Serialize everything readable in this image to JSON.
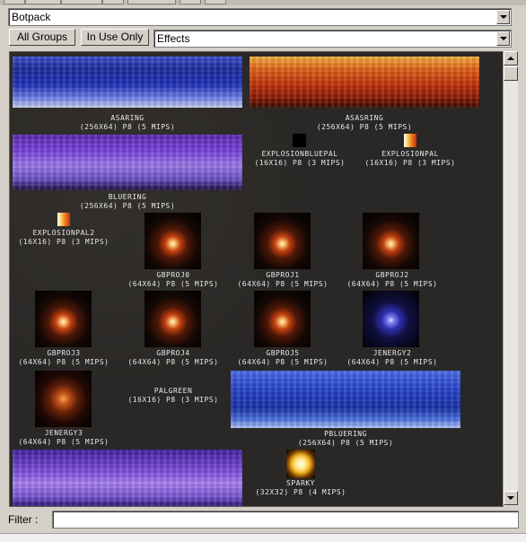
{
  "package_combo": {
    "value": "Botpack"
  },
  "buttons": {
    "all_groups": "All Groups",
    "in_use_only": "In Use Only"
  },
  "group_combo": {
    "value": "Effects"
  },
  "filter": {
    "label": "Filter :",
    "value": ""
  },
  "textures": [
    {
      "name": "ASARING",
      "info": "(256X64) P8 (5 MIPS)",
      "look": "ring-blue"
    },
    {
      "name": "ASASRING",
      "info": "(256X64) P8 (5 MIPS)",
      "look": "ring-fire"
    },
    {
      "name": "BLUERING",
      "info": "(256X64) P8 (5 MIPS)",
      "look": "ring-purple"
    },
    {
      "name": "EXPLOSIONBLUEPAL",
      "info": "(16X16) P8 (3 MIPS)",
      "look": "pal-black"
    },
    {
      "name": "EXPLOSIONPAL",
      "info": "(16X16) P8 (3 MIPS)",
      "look": "pal-fire"
    },
    {
      "name": "EXPLOSIONPAL2",
      "info": "(16X16) P8 (3 MIPS)",
      "look": "pal-fire"
    },
    {
      "name": "GBPROJ0",
      "info": "(64X64) P8 (5 MIPS)",
      "look": "gbp"
    },
    {
      "name": "GBPROJ1",
      "info": "(64X64) P8 (5 MIPS)",
      "look": "gbp"
    },
    {
      "name": "GBPROJ2",
      "info": "(64X64) P8 (5 MIPS)",
      "look": "gbp"
    },
    {
      "name": "GBPROJ3",
      "info": "(64X64) P8 (5 MIPS)",
      "look": "gbp"
    },
    {
      "name": "GBPROJ4",
      "info": "(64X64) P8 (5 MIPS)",
      "look": "gbp"
    },
    {
      "name": "GBPROJ5",
      "info": "(64X64) P8 (5 MIPS)",
      "look": "gbp"
    },
    {
      "name": "JENERGY2",
      "info": "(64X64) P8 (5 MIPS)",
      "look": "jen2"
    },
    {
      "name": "JENERGY3",
      "info": "(64X64) P8 (5 MIPS)",
      "look": "jen3"
    },
    {
      "name": "PALGREEN",
      "info": "(16X16) P8 (3 MIPS)",
      "look": "none"
    },
    {
      "name": "PBLUERING",
      "info": "(256X64) P8 (5 MIPS)",
      "look": "ring-blue2"
    },
    {
      "name": "",
      "info": "",
      "look": "ring-purple2"
    },
    {
      "name": "SPARKY",
      "info": "(32X32) P8 (4 MIPS)",
      "look": "sparky"
    }
  ]
}
